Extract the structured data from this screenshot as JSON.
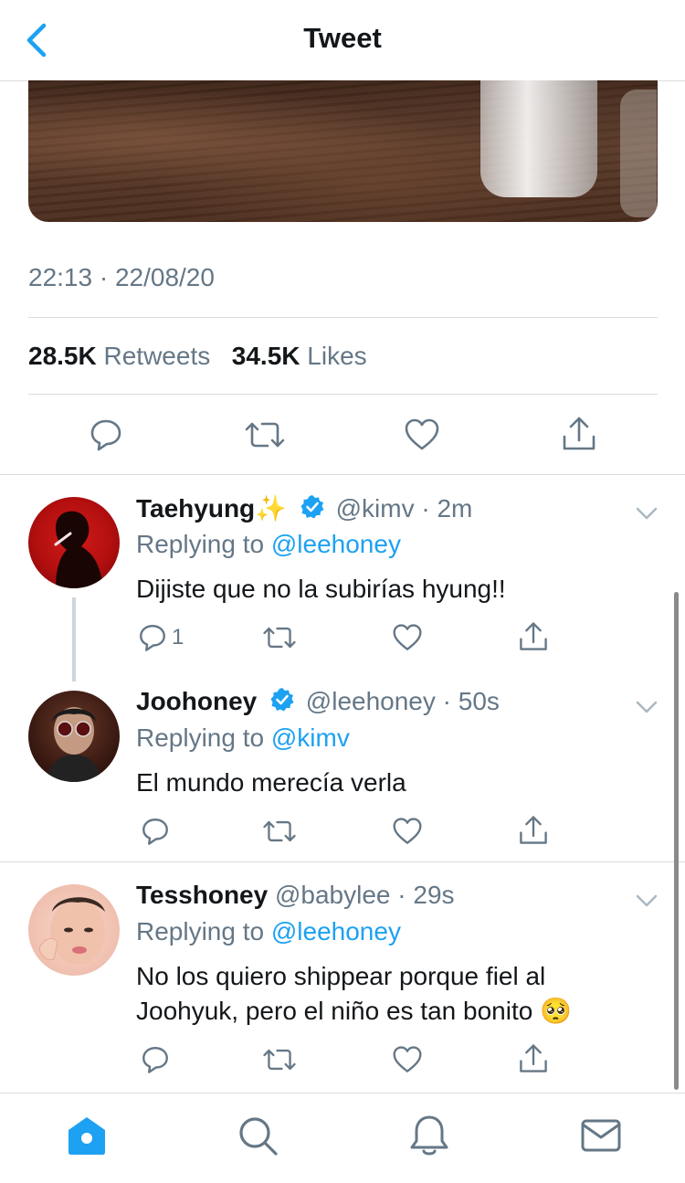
{
  "nav": {
    "title": "Tweet",
    "back_icon": "chevron-left-icon"
  },
  "tweet": {
    "timestamp": "22:13 · 22/08/20",
    "retweets_count": "28.5K",
    "retweets_label": "Retweets",
    "likes_count": "34.5K",
    "likes_label": "Likes"
  },
  "colors": {
    "accent": "#1da1f2",
    "secondary_text": "#657786",
    "divider": "#dcdcdc"
  },
  "replies": [
    {
      "name": "Taehyung✨",
      "handle": "@kimv",
      "dot": "·",
      "time": "2m",
      "verified": true,
      "replying_label": "Replying to",
      "replying_to": "@leehoney",
      "text": "Dijiste que no la subirías hyung!!",
      "reply_count": "1"
    },
    {
      "name": "Joohoney",
      "handle": "@leehoney",
      "dot": "·",
      "time": "50s",
      "verified": true,
      "replying_label": "Replying to",
      "replying_to": "@kimv",
      "text": "El mundo merecía verla",
      "reply_count": ""
    },
    {
      "name": "Tesshoney",
      "handle": "@babylee",
      "dot": "·",
      "time": "29s",
      "verified": false,
      "replying_label": "Replying to",
      "replying_to": "@leehoney",
      "text": "No los quiero shippear porque fiel al Joohyuk, pero el niño es tan bonito 🥺",
      "reply_count": ""
    }
  ],
  "tabbar": {
    "items": [
      "home-icon",
      "search-icon",
      "bell-icon",
      "mail-icon"
    ],
    "active": "home-icon"
  }
}
